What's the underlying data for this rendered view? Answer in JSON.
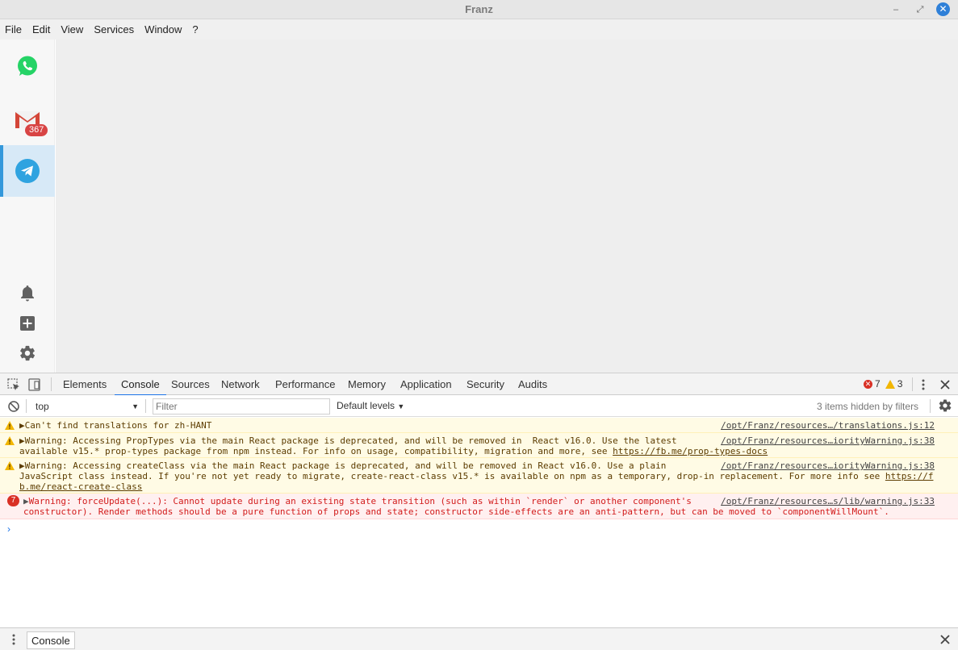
{
  "window": {
    "title": "Franz",
    "minimize_glyph": "–",
    "maximize_glyph": "⤢",
    "close_glyph": "✕"
  },
  "menu": [
    "File",
    "Edit",
    "View",
    "Services",
    "Window",
    "?"
  ],
  "sidebar": {
    "services": [
      {
        "name": "WhatsApp",
        "icon": "whatsapp-icon",
        "active": false
      },
      {
        "name": "Gmail",
        "icon": "gmail-icon",
        "badge": "367",
        "active": false
      },
      {
        "name": "Telegram",
        "icon": "telegram-icon",
        "active": true
      }
    ],
    "bottom_icons": [
      "bell-icon",
      "add-icon",
      "gear-icon"
    ]
  },
  "devtools": {
    "tabs": [
      "Elements",
      "Console",
      "Sources",
      "Network",
      "Performance",
      "Memory",
      "Application",
      "Security",
      "Audits"
    ],
    "active_tab": "Console",
    "error_count": "7",
    "warning_count": "3",
    "context": "top",
    "filter_placeholder": "Filter",
    "levels_label": "Default levels",
    "hidden_message": "3 items hidden by filters",
    "messages": [
      {
        "level": "warning",
        "text": "Can't find translations for zh-HANT",
        "source": "/opt/Franz/resources…/translations.js:12"
      },
      {
        "level": "warning",
        "line1": "Warning: Accessing PropTypes via the main React package is deprecated, and will be removed in  React v16.0. Use the latest",
        "line2": "available v15.* prop-types package from npm instead. For info on usage, compatibility, migration and more, see ",
        "link": "https://fb.me/prop-types-docs",
        "source": "/opt/Franz/resources…iorityWarning.js:38"
      },
      {
        "level": "warning",
        "line1": "Warning: Accessing createClass via the main React package is deprecated, and will be removed in React v16.0. Use a plain",
        "line2": "JavaScript class instead. If you're not yet ready to migrate, create-react-class v15.* is available on npm as a temporary, drop-in replacement. For more info see ",
        "link_part1": "https://f",
        "link_part2": "b.me/react-create-class",
        "source": "/opt/Franz/resources…iorityWarning.js:38"
      },
      {
        "level": "error",
        "repeat": "7",
        "line1": "Warning: forceUpdate(...): Cannot update during an existing state transition (such as within `render` or another component's",
        "line2": "constructor). Render methods should be a pure function of props and state; constructor side-effects are an anti-pattern, but can be moved to `componentWillMount`.",
        "source": "/opt/Franz/resources…s/lib/warning.js:33"
      }
    ],
    "prompt_glyph": "›",
    "drawer_tab": "Console"
  }
}
